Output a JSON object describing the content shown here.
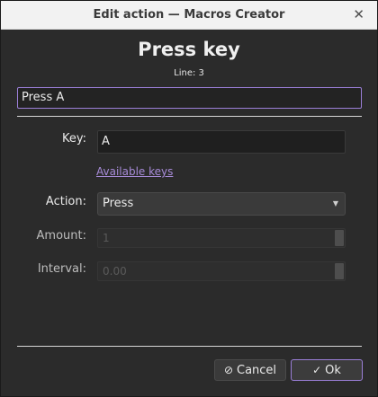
{
  "window": {
    "title": "Edit action — Macros Creator",
    "close_glyph": "✕"
  },
  "header": {
    "title": "Press key",
    "subtitle": "Line: 3"
  },
  "name_field": {
    "value": "Press A"
  },
  "form": {
    "key": {
      "label": "Key:",
      "value": "A"
    },
    "available_keys_link": "Available keys",
    "action": {
      "label": "Action:",
      "value": "Press"
    },
    "amount": {
      "label": "Amount:",
      "value": "1"
    },
    "interval": {
      "label": "Interval:",
      "value": "0.00"
    }
  },
  "buttons": {
    "cancel": {
      "label": "Cancel",
      "icon": "cancel-icon"
    },
    "ok": {
      "label": "Ok",
      "icon": "check-icon"
    }
  },
  "colors": {
    "accent": "#9b7fd8",
    "link": "#a78bd8",
    "background": "#2b2b2b"
  }
}
